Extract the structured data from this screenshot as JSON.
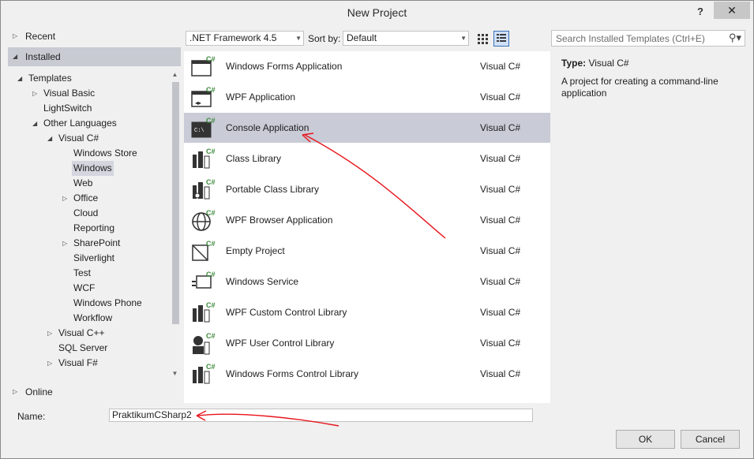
{
  "window": {
    "title": "New Project",
    "help_glyph": "?",
    "close_glyph": "✕"
  },
  "nav": {
    "recent": "Recent",
    "installed": "Installed",
    "online": "Online",
    "tree": [
      {
        "label": "Templates",
        "level": 0,
        "arrow": "open"
      },
      {
        "label": "Visual Basic",
        "level": 1,
        "arrow": "closed"
      },
      {
        "label": "LightSwitch",
        "level": 1,
        "arrow": "none"
      },
      {
        "label": "Other Languages",
        "level": 1,
        "arrow": "open"
      },
      {
        "label": "Visual C#",
        "level": 2,
        "arrow": "open"
      },
      {
        "label": "Windows Store",
        "level": 3,
        "arrow": "none"
      },
      {
        "label": "Windows",
        "level": 3,
        "arrow": "none",
        "selected": true
      },
      {
        "label": "Web",
        "level": 3,
        "arrow": "none"
      },
      {
        "label": "Office",
        "level": 3,
        "arrow": "closed"
      },
      {
        "label": "Cloud",
        "level": 3,
        "arrow": "none"
      },
      {
        "label": "Reporting",
        "level": 3,
        "arrow": "none"
      },
      {
        "label": "SharePoint",
        "level": 3,
        "arrow": "closed"
      },
      {
        "label": "Silverlight",
        "level": 3,
        "arrow": "none"
      },
      {
        "label": "Test",
        "level": 3,
        "arrow": "none"
      },
      {
        "label": "WCF",
        "level": 3,
        "arrow": "none"
      },
      {
        "label": "Windows Phone",
        "level": 3,
        "arrow": "none"
      },
      {
        "label": "Workflow",
        "level": 3,
        "arrow": "none"
      },
      {
        "label": "Visual C++",
        "level": 2,
        "arrow": "closed"
      },
      {
        "label": "SQL Server",
        "level": 2,
        "arrow": "none"
      },
      {
        "label": "Visual F#",
        "level": 2,
        "arrow": "closed"
      }
    ]
  },
  "toolbar": {
    "framework": ".NET Framework 4.5",
    "sort_label": "Sort by:",
    "sort_value": "Default",
    "view_mode": "list"
  },
  "templates": [
    {
      "name": "Windows Forms Application",
      "lang": "Visual C#",
      "icon": "windows-forms-icon"
    },
    {
      "name": "WPF Application",
      "lang": "Visual C#",
      "icon": "wpf-app-icon"
    },
    {
      "name": "Console Application",
      "lang": "Visual C#",
      "icon": "console-icon",
      "selected": true
    },
    {
      "name": "Class Library",
      "lang": "Visual C#",
      "icon": "class-library-icon"
    },
    {
      "name": "Portable Class Library",
      "lang": "Visual C#",
      "icon": "portable-library-icon"
    },
    {
      "name": "WPF Browser Application",
      "lang": "Visual C#",
      "icon": "globe-icon"
    },
    {
      "name": "Empty Project",
      "lang": "Visual C#",
      "icon": "empty-project-icon"
    },
    {
      "name": "Windows Service",
      "lang": "Visual C#",
      "icon": "service-icon"
    },
    {
      "name": "WPF Custom Control Library",
      "lang": "Visual C#",
      "icon": "custom-control-icon"
    },
    {
      "name": "WPF User Control Library",
      "lang": "Visual C#",
      "icon": "user-control-icon"
    },
    {
      "name": "Windows Forms Control Library",
      "lang": "Visual C#",
      "icon": "forms-control-icon"
    }
  ],
  "search": {
    "placeholder": "Search Installed Templates (Ctrl+E)"
  },
  "description": {
    "type_label": "Type:",
    "type_value": "Visual C#",
    "text": "A project for creating a command-line application"
  },
  "bottom": {
    "name_label": "Name:",
    "name_value": "PraktikumCSharp2",
    "ok_label": "OK",
    "cancel_label": "Cancel"
  },
  "colors": {
    "selected_row": "#c9cbd6",
    "csharp_green": "#3c8a3c",
    "annotation_red": "#e8141c"
  }
}
